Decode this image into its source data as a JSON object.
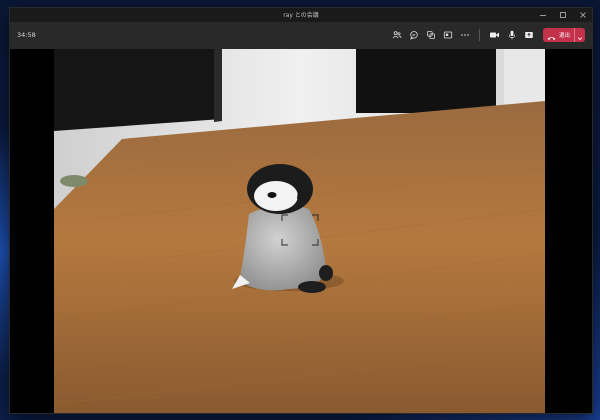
{
  "window": {
    "title": "ray との会議"
  },
  "toolbar": {
    "time": "34:58",
    "leave_label": "退出"
  },
  "icons": {
    "minimize": "minimize-icon",
    "maximize": "maximize-icon",
    "close": "close-icon",
    "participants": "people-icon",
    "chat": "chat-icon",
    "reactions": "reactions-icon",
    "share": "share-screen-icon",
    "more": "more-icon",
    "camera": "camera-icon",
    "mic": "microphone-icon",
    "share_tray": "share-tray-icon",
    "hangup": "phone-hangup-icon",
    "caret": "chevron-down-icon"
  },
  "colors": {
    "leave_button": "#c4314b",
    "toolbar": "#292929",
    "titlebar": "#1a1a1a"
  }
}
